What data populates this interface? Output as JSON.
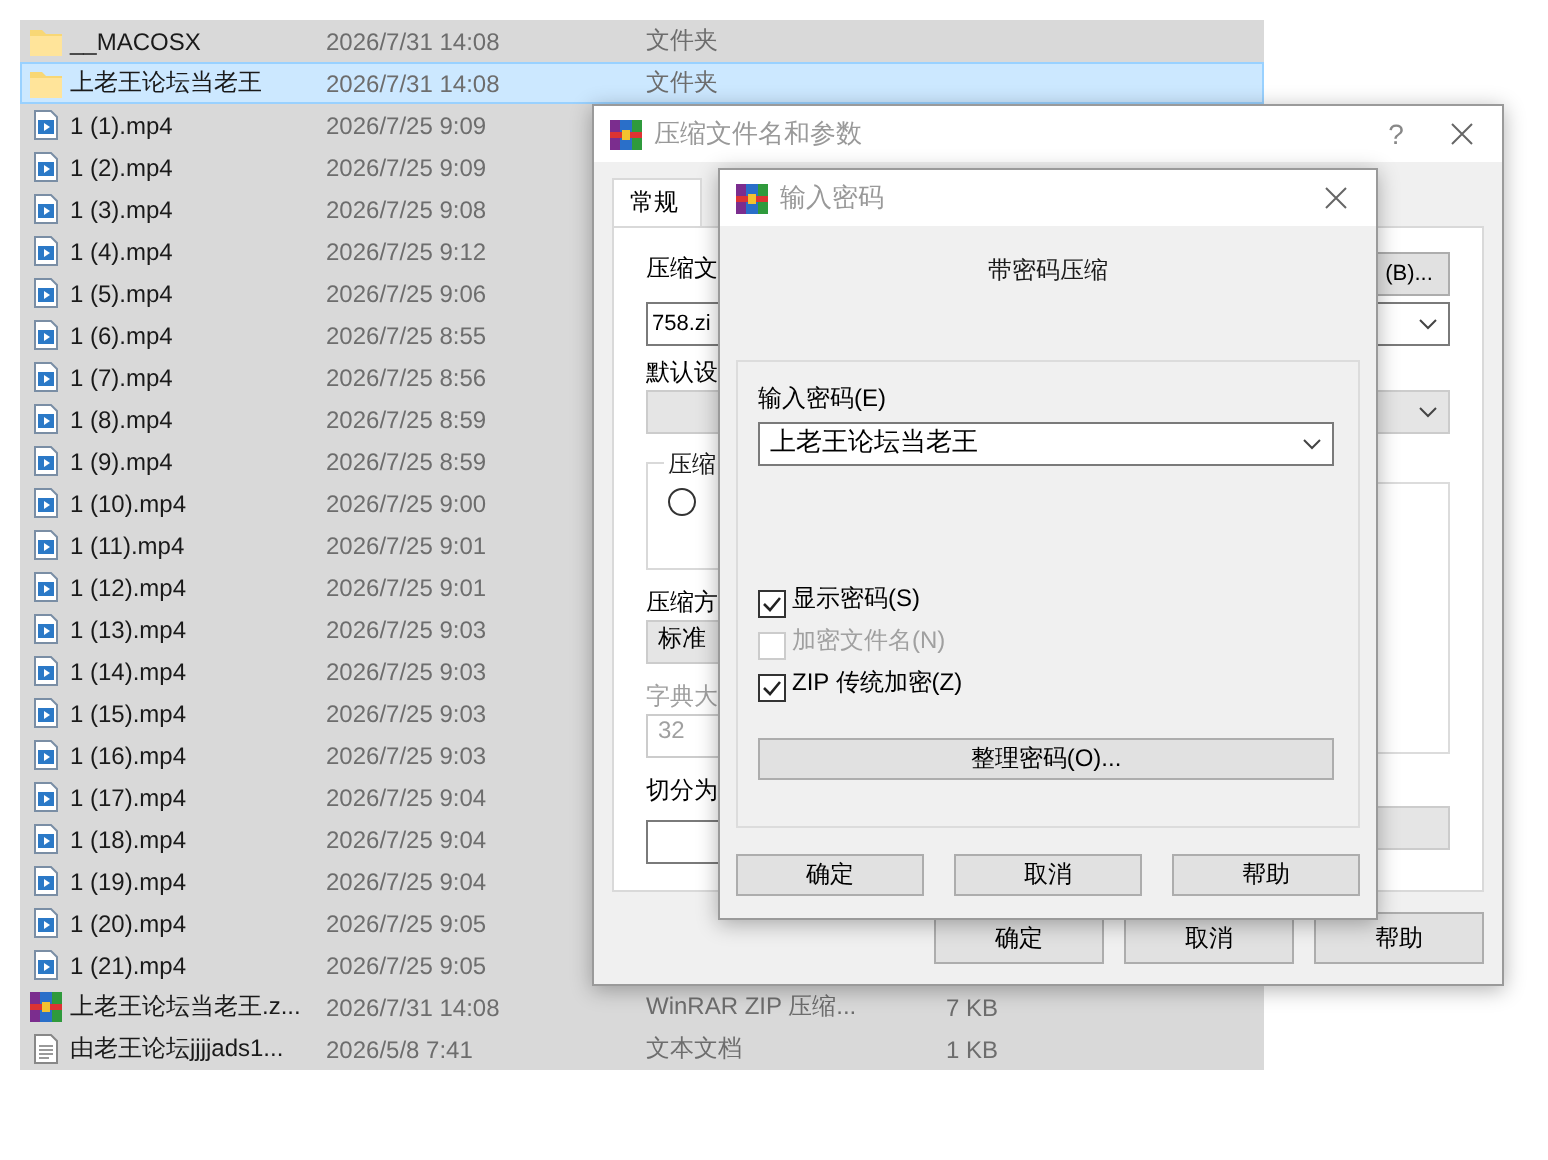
{
  "files": [
    {
      "kind": "folder",
      "name": "__MACOSX",
      "date": "2026/7/31 14:08",
      "type": "文件夹",
      "selected": true,
      "focused": false
    },
    {
      "kind": "folder",
      "name": "上老王论坛当老王",
      "date": "2026/7/31 14:08",
      "type": "文件夹",
      "selected": true,
      "focused": true
    },
    {
      "kind": "video",
      "name": "1 (1).mp4",
      "date": "2026/7/25 9:09",
      "selected": true,
      "focused": false
    },
    {
      "kind": "video",
      "name": "1 (2).mp4",
      "date": "2026/7/25 9:09",
      "selected": true,
      "focused": false
    },
    {
      "kind": "video",
      "name": "1 (3).mp4",
      "date": "2026/7/25 9:08",
      "selected": true,
      "focused": false
    },
    {
      "kind": "video",
      "name": "1 (4).mp4",
      "date": "2026/7/25 9:12",
      "selected": true,
      "focused": false
    },
    {
      "kind": "video",
      "name": "1 (5).mp4",
      "date": "2026/7/25 9:06",
      "selected": true,
      "focused": false
    },
    {
      "kind": "video",
      "name": "1 (6).mp4",
      "date": "2026/7/25 8:55",
      "selected": true,
      "focused": false
    },
    {
      "kind": "video",
      "name": "1 (7).mp4",
      "date": "2026/7/25 8:56",
      "selected": true,
      "focused": false
    },
    {
      "kind": "video",
      "name": "1 (8).mp4",
      "date": "2026/7/25 8:59",
      "selected": true,
      "focused": false
    },
    {
      "kind": "video",
      "name": "1 (9).mp4",
      "date": "2026/7/25 8:59",
      "selected": true,
      "focused": false
    },
    {
      "kind": "video",
      "name": "1 (10).mp4",
      "date": "2026/7/25 9:00",
      "selected": true,
      "focused": false
    },
    {
      "kind": "video",
      "name": "1 (11).mp4",
      "date": "2026/7/25 9:01",
      "selected": true,
      "focused": false
    },
    {
      "kind": "video",
      "name": "1 (12).mp4",
      "date": "2026/7/25 9:01",
      "selected": true,
      "focused": false
    },
    {
      "kind": "video",
      "name": "1 (13).mp4",
      "date": "2026/7/25 9:03",
      "selected": true,
      "focused": false
    },
    {
      "kind": "video",
      "name": "1 (14).mp4",
      "date": "2026/7/25 9:03",
      "selected": true,
      "focused": false
    },
    {
      "kind": "video",
      "name": "1 (15).mp4",
      "date": "2026/7/25 9:03",
      "selected": true,
      "focused": false
    },
    {
      "kind": "video",
      "name": "1 (16).mp4",
      "date": "2026/7/25 9:03",
      "selected": true,
      "focused": false
    },
    {
      "kind": "video",
      "name": "1 (17).mp4",
      "date": "2026/7/25 9:04",
      "selected": true,
      "focused": false
    },
    {
      "kind": "video",
      "name": "1 (18).mp4",
      "date": "2026/7/25 9:04",
      "selected": true,
      "focused": false
    },
    {
      "kind": "video",
      "name": "1 (19).mp4",
      "date": "2026/7/25 9:04",
      "selected": true,
      "focused": false
    },
    {
      "kind": "video",
      "name": "1 (20).mp4",
      "date": "2026/7/25 9:05",
      "selected": true,
      "focused": false
    },
    {
      "kind": "video",
      "name": "1 (21).mp4",
      "date": "2026/7/25 9:05",
      "selected": true,
      "focused": false
    },
    {
      "kind": "archive",
      "name": "上老王论坛当老王.z...",
      "date": "2026/7/31 14:08",
      "type": "WinRAR ZIP 压缩...",
      "size": "7 KB",
      "selected": true,
      "focused": false
    },
    {
      "kind": "text",
      "name": "由老王论坛jjjjads1...",
      "date": "2026/5/8 7:41",
      "type": "文本文档",
      "size": "1 KB",
      "selected": true,
      "focused": false
    }
  ],
  "archive_dialog": {
    "title": "压缩文件名和参数",
    "help": "?",
    "tabs": [
      {
        "label": "常规",
        "selected": true
      }
    ],
    "archive_name_label": "压缩文",
    "browse_button": "(B)...",
    "archive_name": "758.zi",
    "profile_label": "默认设",
    "group_label": "压缩",
    "radio": {
      "checked": false
    },
    "method_label": "压缩方",
    "method": "标准",
    "dictionary_label": "字典大",
    "dictionary": "32",
    "split_label": "切分为",
    "buttons": [
      "确定",
      "取消",
      "帮助"
    ]
  },
  "password_dialog": {
    "title": "输入密码",
    "heading": "带密码压缩",
    "password_label": "输入密码(E)",
    "password": "上老王论坛当老王",
    "options": [
      {
        "label": "显示密码(S)",
        "checked": true,
        "disabled": false
      },
      {
        "label": "加密文件名(N)",
        "checked": false,
        "disabled": true
      },
      {
        "label": "ZIP 传统加密(Z)",
        "checked": true,
        "disabled": false
      }
    ],
    "organize_button": "整理密码(O)...",
    "buttons": [
      "确定",
      "取消",
      "帮助"
    ]
  }
}
